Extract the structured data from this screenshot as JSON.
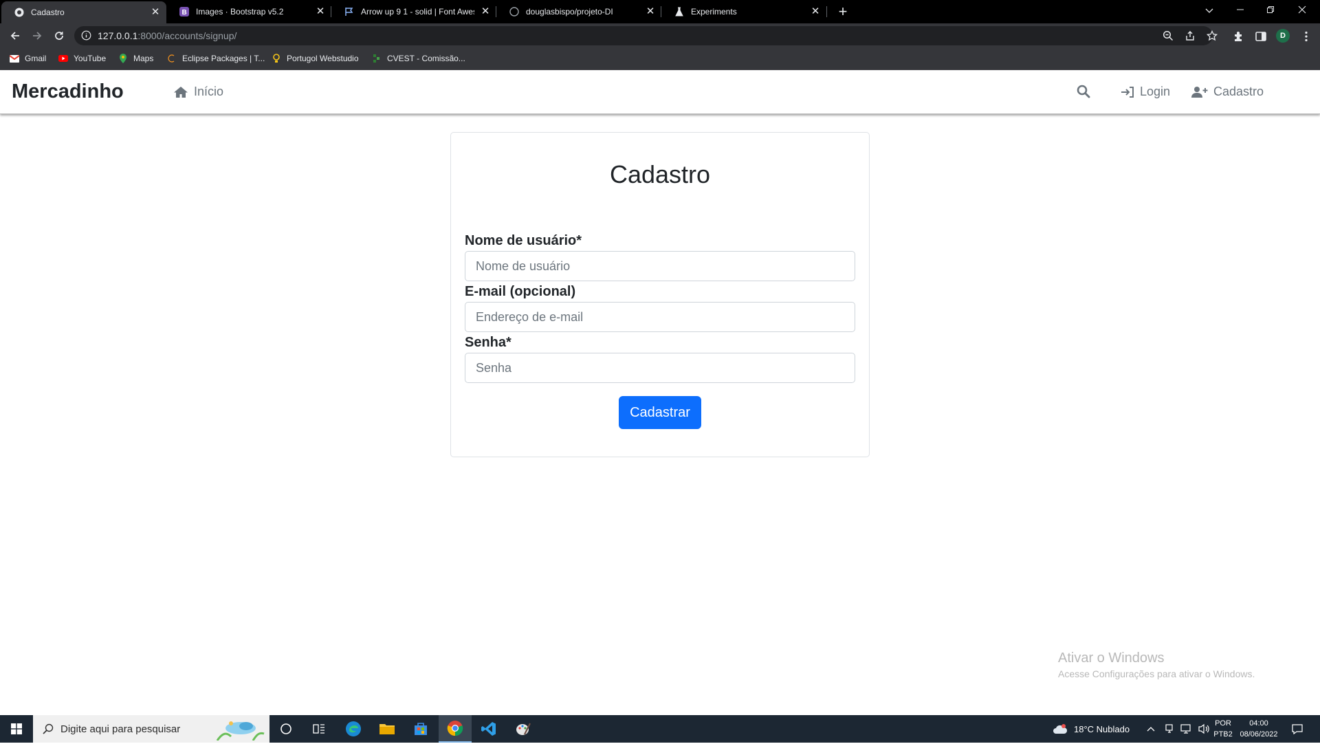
{
  "browser": {
    "tabs": [
      {
        "title": "Cadastro",
        "icon": "django-icon",
        "active": true
      },
      {
        "title": "Images · Bootstrap v5.2",
        "icon": "bootstrap-icon",
        "active": false
      },
      {
        "title": "Arrow up 9 1 - solid | Font Awesome",
        "icon": "flag-icon",
        "active": false
      },
      {
        "title": "douglasbispo/projeto-DI",
        "icon": "github-icon",
        "active": false
      },
      {
        "title": "Experiments",
        "icon": "flask-icon",
        "active": false
      }
    ],
    "url_host": "127.0.0.1",
    "url_path": ":8000/accounts/signup/",
    "profile_initial": "D",
    "bookmarks": [
      {
        "label": "Gmail",
        "icon": "gmail-icon"
      },
      {
        "label": "YouTube",
        "icon": "youtube-icon"
      },
      {
        "label": "Maps",
        "icon": "maps-icon"
      },
      {
        "label": "Eclipse Packages | T...",
        "icon": "eclipse-icon"
      },
      {
        "label": "Portugol Webstudio",
        "icon": "portugol-icon"
      },
      {
        "label": "CVEST - Comissão...",
        "icon": "cvest-icon"
      }
    ]
  },
  "navbar": {
    "brand": "Mercadinho",
    "home_label": "Início",
    "login_label": "Login",
    "signup_label": "Cadastro"
  },
  "form": {
    "title": "Cadastro",
    "username_label": "Nome de usuário*",
    "username_placeholder": "Nome de usuário",
    "email_label": "E-mail (opcional)",
    "email_placeholder": "Endereço de e-mail",
    "password_label": "Senha*",
    "password_placeholder": "Senha",
    "submit_label": "Cadastrar"
  },
  "watermark": {
    "title": "Ativar o Windows",
    "subtitle": "Acesse Configurações para ativar o Windows."
  },
  "taskbar": {
    "search_placeholder": "Digite aqui para pesquisar",
    "weather": "18°C  Nublado",
    "lang_top": "POR",
    "lang_bottom": "PTB2",
    "time": "04:00",
    "date": "08/06/2022"
  },
  "colors": {
    "primary": "#0d6efd",
    "chrome_dark": "#35363a",
    "taskbar": "#1c2733"
  }
}
